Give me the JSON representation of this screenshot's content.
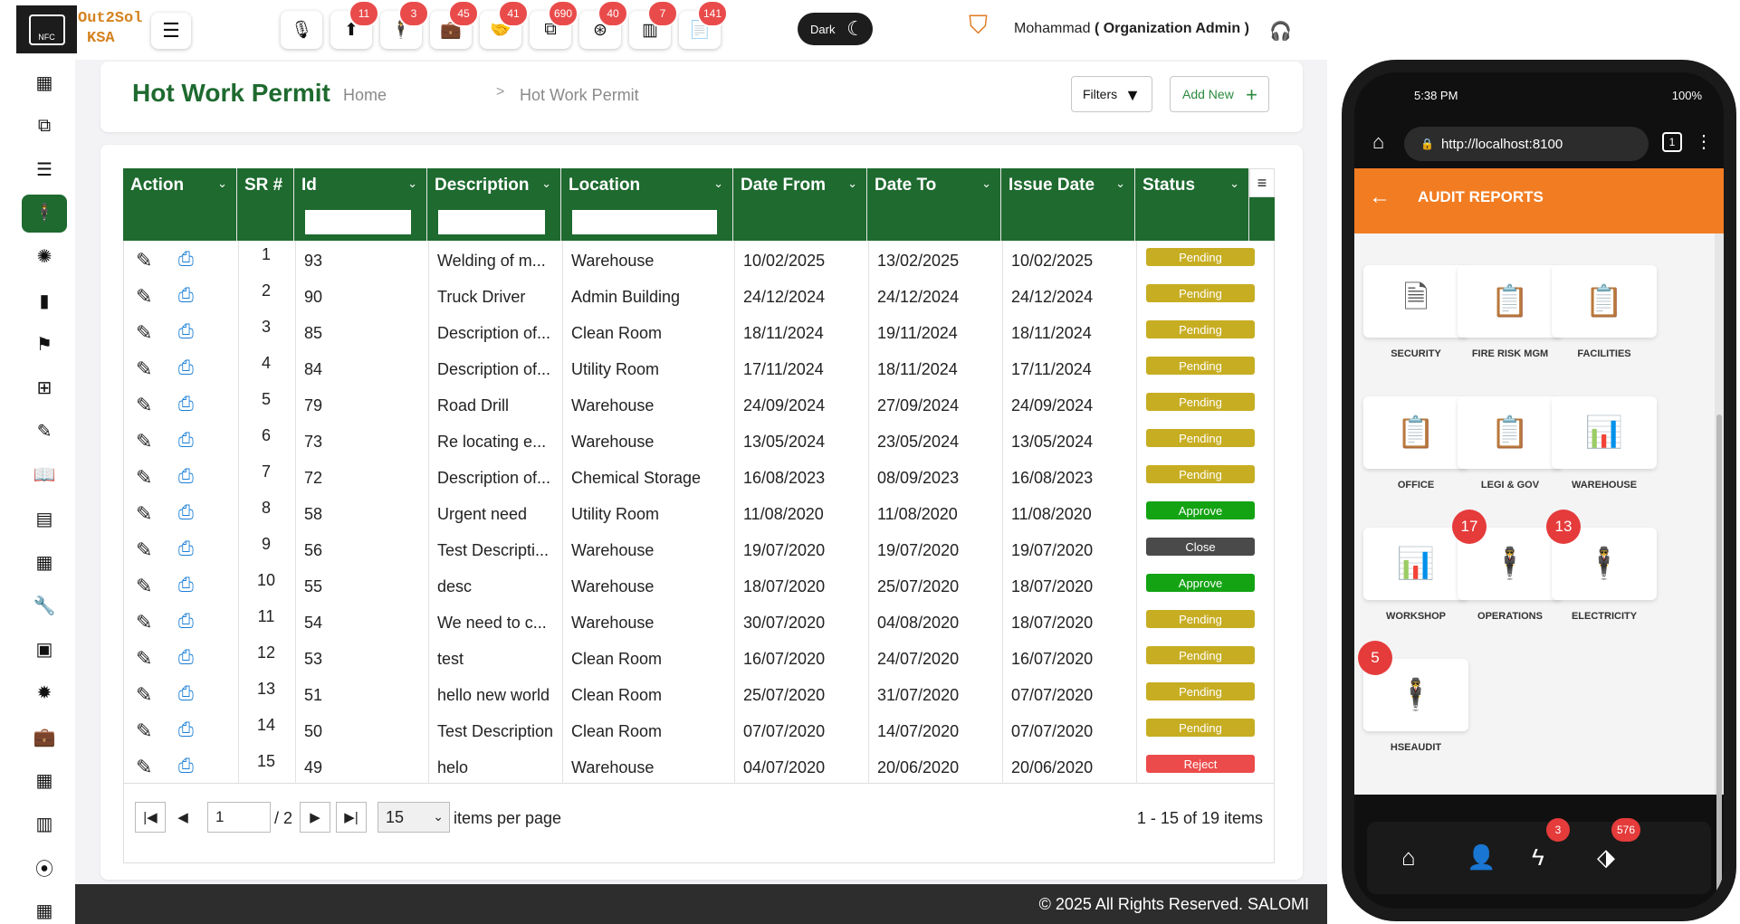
{
  "header": {
    "logo_text": "NFC",
    "brand_line1": "Out2Sol",
    "brand_line2": "KSA",
    "toolbar": [
      {
        "icon": "microphone-icon",
        "glyph": "🎙",
        "badge": ""
      },
      {
        "icon": "torch-icon",
        "glyph": "⬆",
        "badge": "11"
      },
      {
        "icon": "person-icon",
        "glyph": "🕴",
        "badge": "3"
      },
      {
        "icon": "briefcase-icon",
        "glyph": "💼",
        "badge": "45"
      },
      {
        "icon": "handshake-icon",
        "glyph": "🤝",
        "badge": "41"
      },
      {
        "icon": "copy-icon",
        "glyph": "⧉",
        "badge": "690"
      },
      {
        "icon": "lifebuoy-icon",
        "glyph": "⊛",
        "badge": "40"
      },
      {
        "icon": "barcode-icon",
        "glyph": "▥",
        "badge": "7"
      },
      {
        "icon": "document-icon",
        "glyph": "📄",
        "badge": "141"
      }
    ],
    "dark_label": "Dark",
    "user_name": "Mohammad",
    "user_role": "( Organization Admin )"
  },
  "sidebar": {
    "items": [
      {
        "name": "table-icon",
        "glyph": "▦",
        "active": false
      },
      {
        "name": "copy-icon",
        "glyph": "⧉",
        "active": false
      },
      {
        "name": "list-icon",
        "glyph": "☰",
        "active": false
      },
      {
        "name": "person-icon",
        "glyph": "🕴",
        "active": true
      },
      {
        "name": "virus-icon",
        "glyph": "✺",
        "active": false
      },
      {
        "name": "bar-chart-icon",
        "glyph": "▮",
        "active": false
      },
      {
        "name": "teacher-icon",
        "glyph": "⚑",
        "active": false
      },
      {
        "name": "medical-monitor-icon",
        "glyph": "⊞",
        "active": false
      },
      {
        "name": "pencil-icon",
        "glyph": "✎",
        "active": false
      },
      {
        "name": "book-icon",
        "glyph": "📖",
        "active": false
      },
      {
        "name": "notebook-icon",
        "glyph": "▤",
        "active": false
      },
      {
        "name": "checklist-icon",
        "glyph": "▦",
        "active": false
      },
      {
        "name": "wrench-icon",
        "glyph": "🔧",
        "active": false
      },
      {
        "name": "chip-icon",
        "glyph": "▣",
        "active": false
      },
      {
        "name": "gear-icon",
        "glyph": "✹",
        "active": false
      },
      {
        "name": "toolbox-icon",
        "glyph": "💼",
        "active": false
      },
      {
        "name": "building-icon",
        "glyph": "▦",
        "active": false
      },
      {
        "name": "barcode-icon",
        "glyph": "▥",
        "active": false
      },
      {
        "name": "location-icon",
        "glyph": "⦿",
        "active": false
      },
      {
        "name": "grid-icon",
        "glyph": "▦",
        "active": false
      }
    ]
  },
  "page": {
    "title": "Hot Work Permit",
    "breadcrumb_home": "Home",
    "breadcrumb_sep": ">",
    "breadcrumb_current": "Hot Work Permit",
    "filters_label": "Filters",
    "add_new_label": "Add New"
  },
  "table": {
    "columns": [
      "Action",
      "SR #",
      "Id",
      "Description",
      "Location",
      "Date From",
      "Date To",
      "Issue Date",
      "Status"
    ],
    "rows": [
      {
        "sr": "1",
        "id": "93",
        "description": "Welding of m...",
        "location": "Warehouse",
        "date_from": "10/02/2025",
        "date_to": "13/02/2025",
        "issue_date": "10/02/2025",
        "status": "Pending"
      },
      {
        "sr": "2",
        "id": "90",
        "description": "Truck Driver",
        "location": "Admin Building",
        "date_from": "24/12/2024",
        "date_to": "24/12/2024",
        "issue_date": "24/12/2024",
        "status": "Pending"
      },
      {
        "sr": "3",
        "id": "85",
        "description": "Description of...",
        "location": "Clean Room",
        "date_from": "18/11/2024",
        "date_to": "19/11/2024",
        "issue_date": "18/11/2024",
        "status": "Pending"
      },
      {
        "sr": "4",
        "id": "84",
        "description": "Description of...",
        "location": "Utility Room",
        "date_from": "17/11/2024",
        "date_to": "18/11/2024",
        "issue_date": "17/11/2024",
        "status": "Pending"
      },
      {
        "sr": "5",
        "id": "79",
        "description": "Road Drill",
        "location": "Warehouse",
        "date_from": "24/09/2024",
        "date_to": "27/09/2024",
        "issue_date": "24/09/2024",
        "status": "Pending"
      },
      {
        "sr": "6",
        "id": "73",
        "description": "Re locating e...",
        "location": "Warehouse",
        "date_from": "13/05/2024",
        "date_to": "23/05/2024",
        "issue_date": "13/05/2024",
        "status": "Pending"
      },
      {
        "sr": "7",
        "id": "72",
        "description": "Description of...",
        "location": "Chemical Storage",
        "date_from": "16/08/2023",
        "date_to": "08/09/2023",
        "issue_date": "16/08/2023",
        "status": "Pending"
      },
      {
        "sr": "8",
        "id": "58",
        "description": "Urgent need",
        "location": "Utility Room",
        "date_from": "11/08/2020",
        "date_to": "11/08/2020",
        "issue_date": "11/08/2020",
        "status": "Approve"
      },
      {
        "sr": "9",
        "id": "56",
        "description": "Test Descripti...",
        "location": "Warehouse",
        "date_from": "19/07/2020",
        "date_to": "19/07/2020",
        "issue_date": "19/07/2020",
        "status": "Close"
      },
      {
        "sr": "10",
        "id": "55",
        "description": "desc",
        "location": "Warehouse",
        "date_from": "18/07/2020",
        "date_to": "25/07/2020",
        "issue_date": "18/07/2020",
        "status": "Approve"
      },
      {
        "sr": "11",
        "id": "54",
        "description": "We need to c...",
        "location": "Warehouse",
        "date_from": "30/07/2020",
        "date_to": "04/08/2020",
        "issue_date": "18/07/2020",
        "status": "Pending"
      },
      {
        "sr": "12",
        "id": "53",
        "description": "test",
        "location": "Clean Room",
        "date_from": "16/07/2020",
        "date_to": "24/07/2020",
        "issue_date": "16/07/2020",
        "status": "Pending"
      },
      {
        "sr": "13",
        "id": "51",
        "description": "hello new world",
        "location": "Clean Room",
        "date_from": "25/07/2020",
        "date_to": "31/07/2020",
        "issue_date": "07/07/2020",
        "status": "Pending"
      },
      {
        "sr": "14",
        "id": "50",
        "description": "Test Description",
        "location": "Clean Room",
        "date_from": "07/07/2020",
        "date_to": "14/07/2020",
        "issue_date": "07/07/2020",
        "status": "Pending"
      },
      {
        "sr": "15",
        "id": "49",
        "description": "helo",
        "location": "Warehouse",
        "date_from": "04/07/2020",
        "date_to": "20/06/2020",
        "issue_date": "20/06/2020",
        "status": "Reject"
      }
    ],
    "status_colors": {
      "Pending": "#c7ad22",
      "Approve": "#13a313",
      "Close": "#4a4a4a",
      "Reject": "#ec4b4b"
    },
    "header_color": "#1e6a2f"
  },
  "pager": {
    "page_value": "1",
    "of_text": "/ 2",
    "page_size": "15",
    "items_per_page": "items per page",
    "range_text": "1 - 15 of 19 items"
  },
  "footer": {
    "text": "© 2025 All Rights Reserved. SALOMI"
  },
  "phone": {
    "time": "5:38 PM",
    "battery": "100%",
    "url": "http://localhost:8100",
    "tab_count": "1",
    "screen_title": "AUDIT REPORTS",
    "tiles": [
      {
        "label": "SECURITY",
        "icon": "security-report-icon",
        "glyph": "🗎",
        "badge": ""
      },
      {
        "label": "FIRE RISK MGM",
        "icon": "fire-risk-report-icon",
        "glyph": "📋",
        "badge": ""
      },
      {
        "label": "FACILITIES",
        "icon": "facilities-report-icon",
        "glyph": "📋",
        "badge": ""
      },
      {
        "label": "OFFICE",
        "icon": "office-report-icon",
        "glyph": "📋",
        "badge": ""
      },
      {
        "label": "LEGI & GOV",
        "icon": "legal-report-icon",
        "glyph": "📋",
        "badge": ""
      },
      {
        "label": "WAREHOUSE",
        "icon": "warehouse-report-icon",
        "glyph": "📊",
        "badge": ""
      },
      {
        "label": "WORKSHOP",
        "icon": "workshop-report-icon",
        "glyph": "📊",
        "badge": ""
      },
      {
        "label": "OPERATIONS",
        "icon": "operations-person-icon",
        "glyph": "🕴",
        "badge": "17"
      },
      {
        "label": "ELECTRICITY",
        "icon": "electricity-person-icon",
        "glyph": "🕴",
        "badge": "13"
      },
      {
        "label": "HSEAUDIT",
        "icon": "hseaudit-person-icon",
        "glyph": "🕴",
        "badge": "5"
      }
    ],
    "tabbar": [
      {
        "icon": "home-icon",
        "glyph": "⌂",
        "badge": ""
      },
      {
        "icon": "user-icon",
        "glyph": "👤",
        "badge": ""
      },
      {
        "icon": "lightning-icon",
        "glyph": "ϟ",
        "badge": "3"
      },
      {
        "icon": "tag-icon",
        "glyph": "⬗",
        "badge": "576"
      }
    ]
  }
}
